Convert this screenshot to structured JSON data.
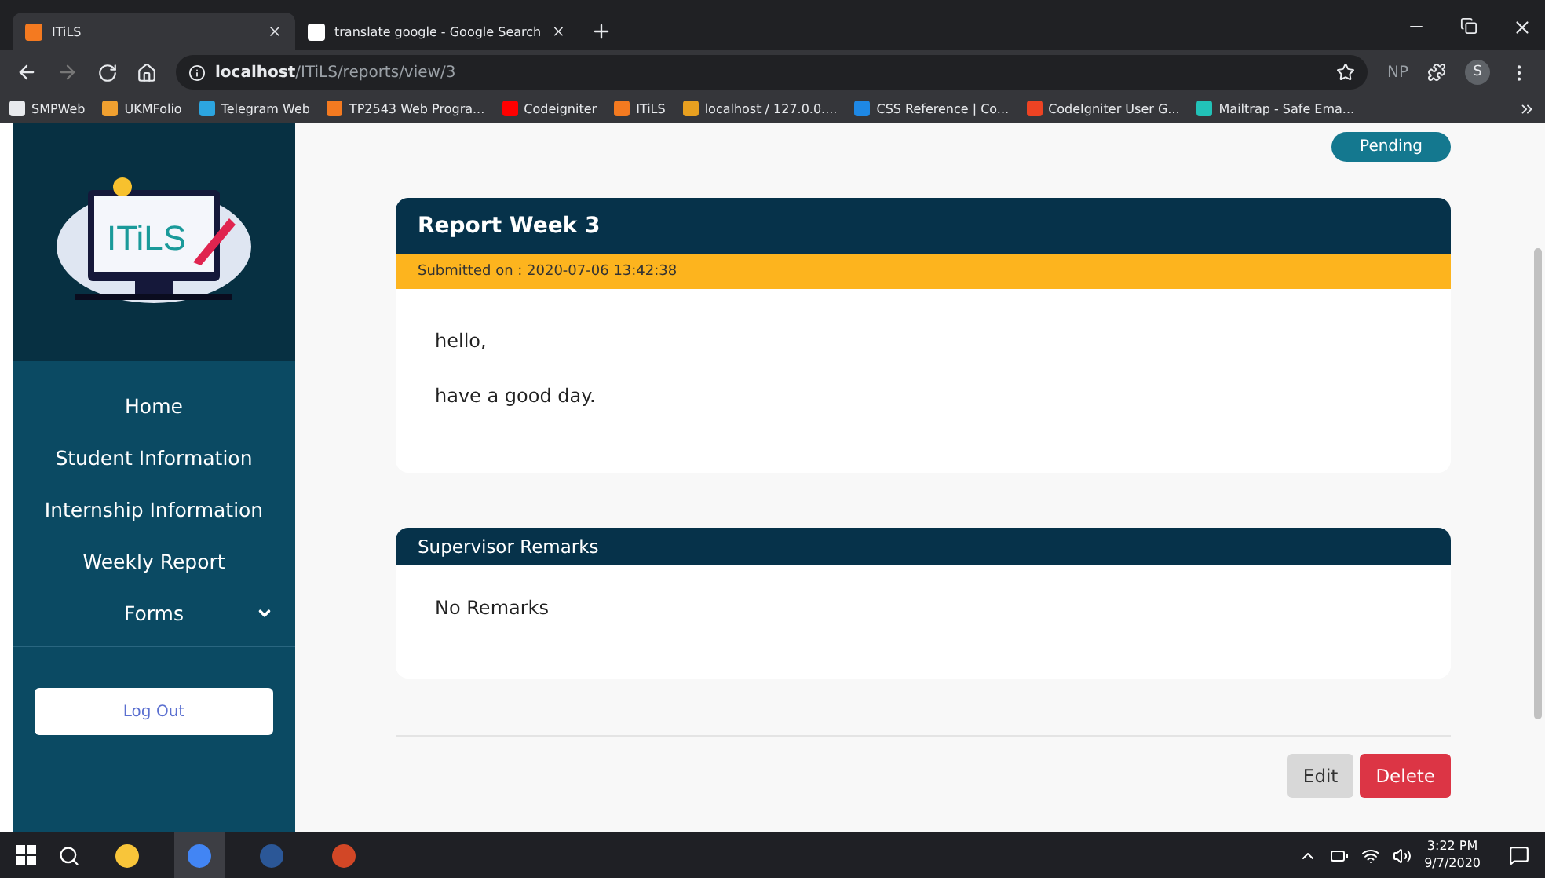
{
  "browser": {
    "tabs": [
      {
        "title": "ITiLS",
        "selected": true
      },
      {
        "title": "translate google - Google Search",
        "selected": false
      }
    ],
    "address": "**localhost**/ITiLS/reports/view/3",
    "extension": "NP",
    "profile": "S",
    "bookmarks": [
      {
        "label": "SMPWeb",
        "color": "#e8eaed"
      },
      {
        "label": "UKMFolio",
        "color": "#f0a030"
      },
      {
        "label": "Telegram Web",
        "color": "#2ca5e0"
      },
      {
        "label": "TP2543 Web Progra...",
        "color": "#f47a20"
      },
      {
        "label": "Codeigniter",
        "color": "#ff0000"
      },
      {
        "label": "ITiLS",
        "color": "#f47a20"
      },
      {
        "label": "localhost / 127.0.0....",
        "color": "#e8a020"
      },
      {
        "label": "CSS Reference | Co...",
        "color": "#1e88e5"
      },
      {
        "label": "CodeIgniter User G...",
        "color": "#ee4323"
      },
      {
        "label": "Mailtrap - Safe Ema...",
        "color": "#22c2b8"
      }
    ]
  },
  "sidebar": {
    "logo": "ITiLS",
    "nav": [
      {
        "label": "Home",
        "kind": "link"
      },
      {
        "label": "Student Information",
        "kind": "link"
      },
      {
        "label": "Internship Information",
        "kind": "link"
      },
      {
        "label": "Weekly Report",
        "kind": "link"
      },
      {
        "label": "Forms",
        "kind": "dropdown"
      }
    ],
    "logout": "Log Out"
  },
  "main": {
    "status": "Pending",
    "report": {
      "title": "Report Week 3",
      "submitted": "Submitted on : 2020-07-06 13:42:38",
      "paragraphs": [
        "hello,",
        "have a good day."
      ]
    },
    "remarks": {
      "title": "Supervisor Remarks",
      "text": "No Remarks"
    },
    "buttons": [
      {
        "label": "Edit",
        "kind": "secondary"
      },
      {
        "label": "Delete",
        "kind": "danger"
      }
    ]
  },
  "taskbar": {
    "apps": [
      {
        "kind": "files",
        "selected": false
      },
      {
        "kind": "chrome",
        "selected": true
      },
      {
        "kind": "word",
        "selected": false
      },
      {
        "kind": "powerpoint",
        "selected": false
      }
    ],
    "time": "3:22 PM",
    "date": "9/7/2020"
  }
}
